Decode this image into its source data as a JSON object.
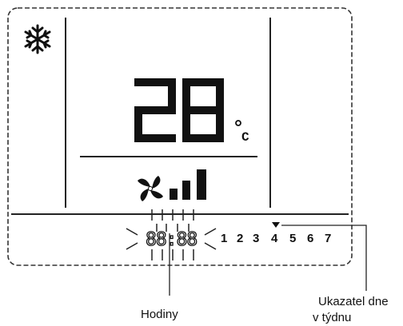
{
  "display": {
    "temperature": "28",
    "temperature_unit": "°C",
    "clock_segments": "88:88",
    "weekdays": [
      "1",
      "2",
      "3",
      "4",
      "5",
      "6",
      "7"
    ],
    "current_day": "4",
    "fan_speed_level": 3,
    "fan_speed_max": 3,
    "mode_icon": "snowflake-icon",
    "fan_icon": "fan-icon"
  },
  "labels": {
    "clock": "Hodiny",
    "day_indicator_line1": "Ukazatel dne",
    "day_indicator_line2": "v týdnu"
  },
  "colors": {
    "ink": "#111111",
    "line": "#333333",
    "background": "#ffffff"
  }
}
